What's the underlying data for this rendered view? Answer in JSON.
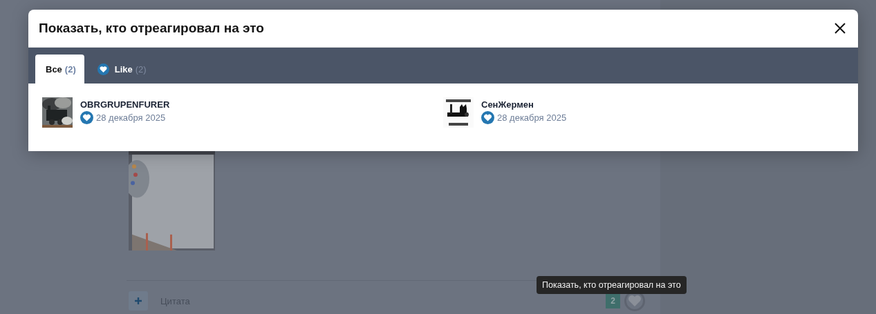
{
  "dialog": {
    "title": "Показать, кто отреагировал на это"
  },
  "tabs": [
    {
      "kind": "all",
      "label": "Все",
      "count": "(2)",
      "selected": true
    },
    {
      "kind": "reaction",
      "label": "Like",
      "count": "(2)",
      "selected": false
    }
  ],
  "reactions": [
    {
      "name": "OBRGRUPENFURER",
      "date": "28 декабря 2025"
    },
    {
      "name": "СенЖермен",
      "date": "28 декабря 2025"
    }
  ],
  "post": {
    "quote_label": "Цитата",
    "reaction_count": "2",
    "tooltip": "Показать, кто отреагировал на это"
  }
}
